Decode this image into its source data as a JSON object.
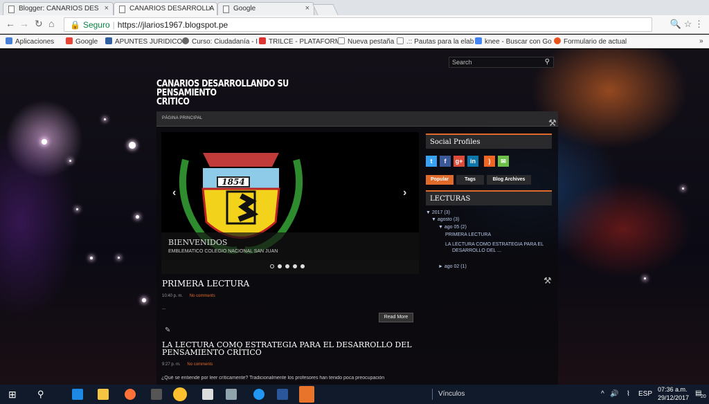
{
  "browser": {
    "tabs": [
      {
        "label": "Blogger: CANARIOS DES",
        "close": "×"
      },
      {
        "label": "CANARIOS DESARROLLA",
        "close": "×"
      },
      {
        "label": "Google",
        "close": "×"
      }
    ],
    "secure_label": "Seguro",
    "url": "https://jlarios1967.blogspot.pe",
    "bookmarks": [
      "Aplicaciones",
      "Google",
      "APUNTES JURIDICOS",
      "Curso: Ciudadanía - I",
      "TRILCE - PLATAFORM",
      "Nueva pestaña",
      ".:: Pautas para la elab",
      "knee - Buscar con Go",
      "Formulario de actual"
    ],
    "overflow": "»"
  },
  "blog": {
    "search_placeholder": "Search",
    "title_line1": "CANARIOS DESARROLLANDO SU PENSAMIENTO",
    "title_line2": "CRITICO",
    "nav_home": "PÁGINA PRINCIPAL",
    "slider": {
      "badge_year": "1854",
      "caption_title": "BIENVENIDOS",
      "caption_sub": "EMBLEMATICO COLEGIO NACIONAL SAN JUAN"
    },
    "sidebar": {
      "social_title": "Social Profiles",
      "tabs": [
        "Popular",
        "Tags",
        "Blog Archives"
      ],
      "lecturas_title": "LECTURAS",
      "archive": {
        "year": "▼ 2017 (3)",
        "month": "▼ agosto (3)",
        "day1": "▼ ago 05 (2)",
        "post1": "PRIMERA LECTURA",
        "post2a": "LA LECTURA COMO ESTRATEGIA PARA EL",
        "post2b": "DESARROLLO DEL ...",
        "day2": "► ago 02 (1)"
      }
    },
    "posts": [
      {
        "title": "PRIMERA LECTURA",
        "time": "10:40 p. m.",
        "comments": "No comments",
        "ellipsis": "...",
        "read_more": "Read More"
      },
      {
        "title_line1": "LA LECTURA COMO ESTRATEGIA PARA EL DESARROLLO DEL",
        "title_line2": "PENSAMIENTO CRÍTICO",
        "time": "9:27 p. m.",
        "comments": "No comments",
        "excerpt": "¿Qué se entiende por leer críticamente? Tradicionalmente los profesores han tenido poca preocupación"
      }
    ]
  },
  "taskbar": {
    "links_label": "Vínculos",
    "language": "ESP",
    "time": "07:36 a.m.",
    "date": "29/12/2017",
    "notif_badge": "20"
  }
}
